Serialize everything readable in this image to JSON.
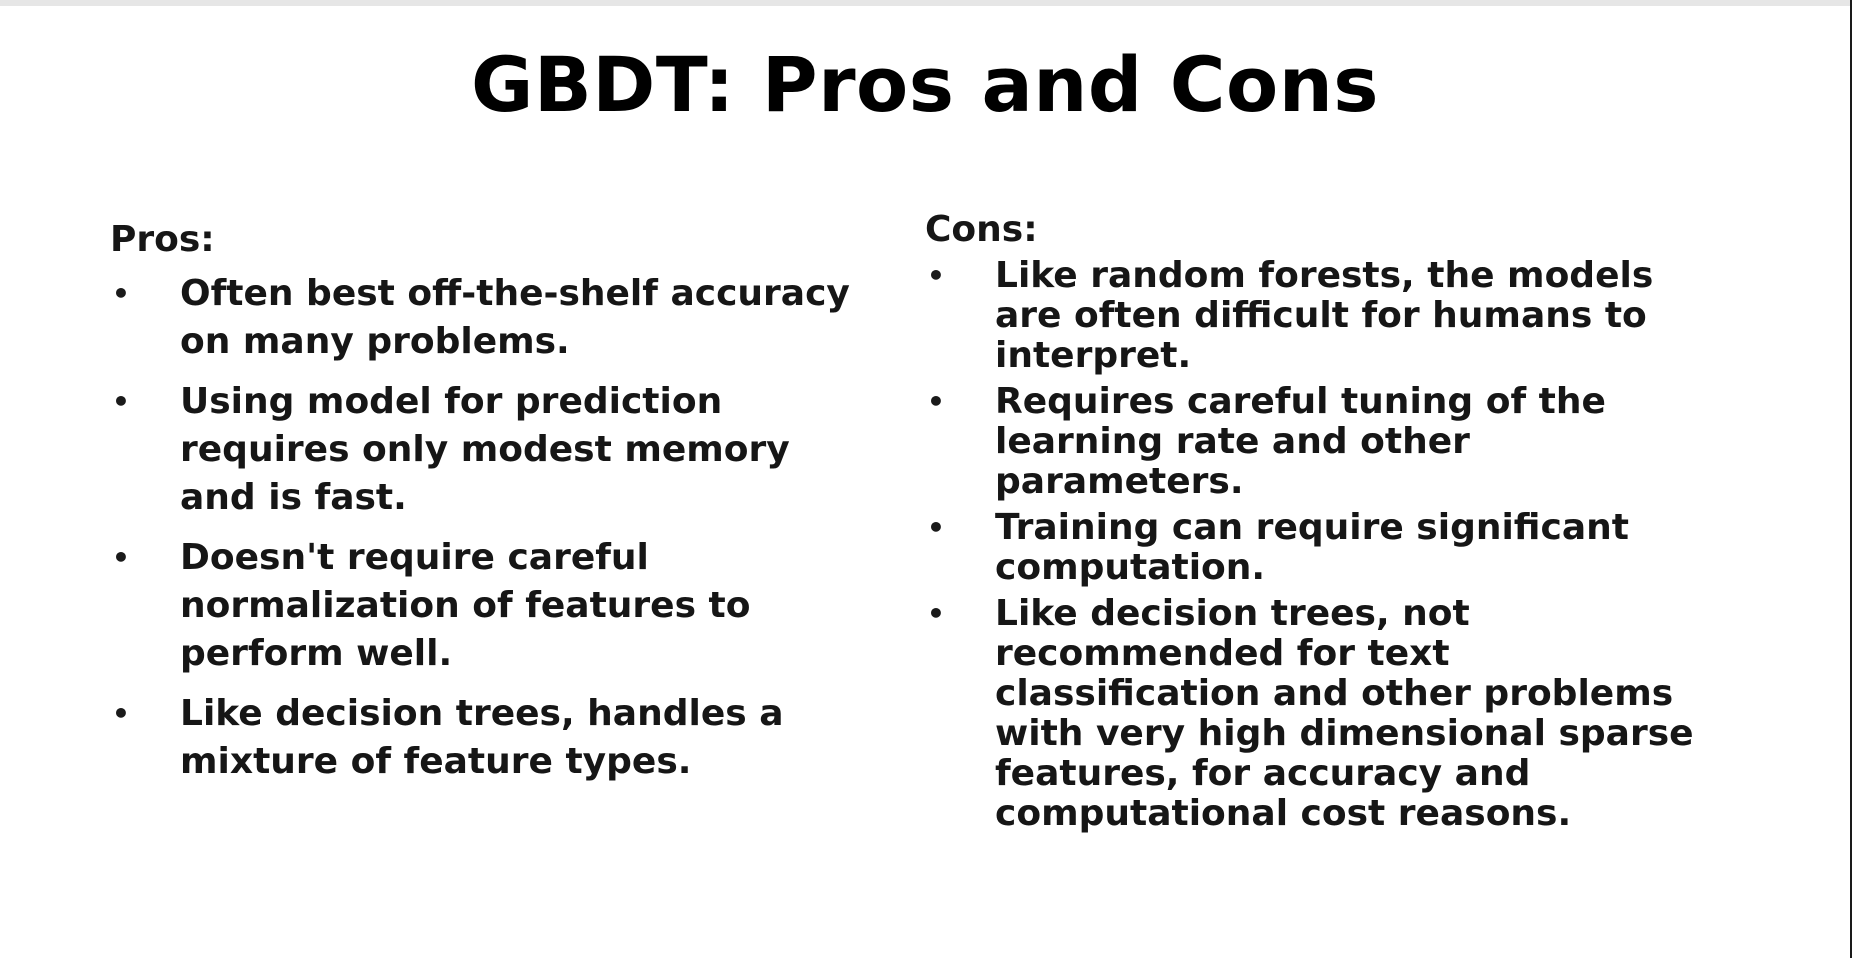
{
  "slide": {
    "title": "GBDT: Pros and Cons",
    "pros": {
      "heading": "Pros:",
      "items": [
        "Often best off-the-shelf accuracy on many problems.",
        "Using model for prediction requires only modest memory and is fast.",
        "Doesn't require careful normalization of features to perform well.",
        "Like decision trees, handles a mixture of feature types."
      ]
    },
    "cons": {
      "heading": "Cons:",
      "items": [
        "Like random forests, the models are often difficult for humans to interpret.",
        "Requires careful tuning of the learning rate and other parameters.",
        "Training can require significant computation.",
        "Like decision trees, not recommended for text classification and other problems with very high dimensional sparse features, for accuracy and computational cost reasons."
      ]
    },
    "bullet_glyph": "•",
    "colors": {
      "background": "#ffffff",
      "text": "#111111"
    }
  }
}
